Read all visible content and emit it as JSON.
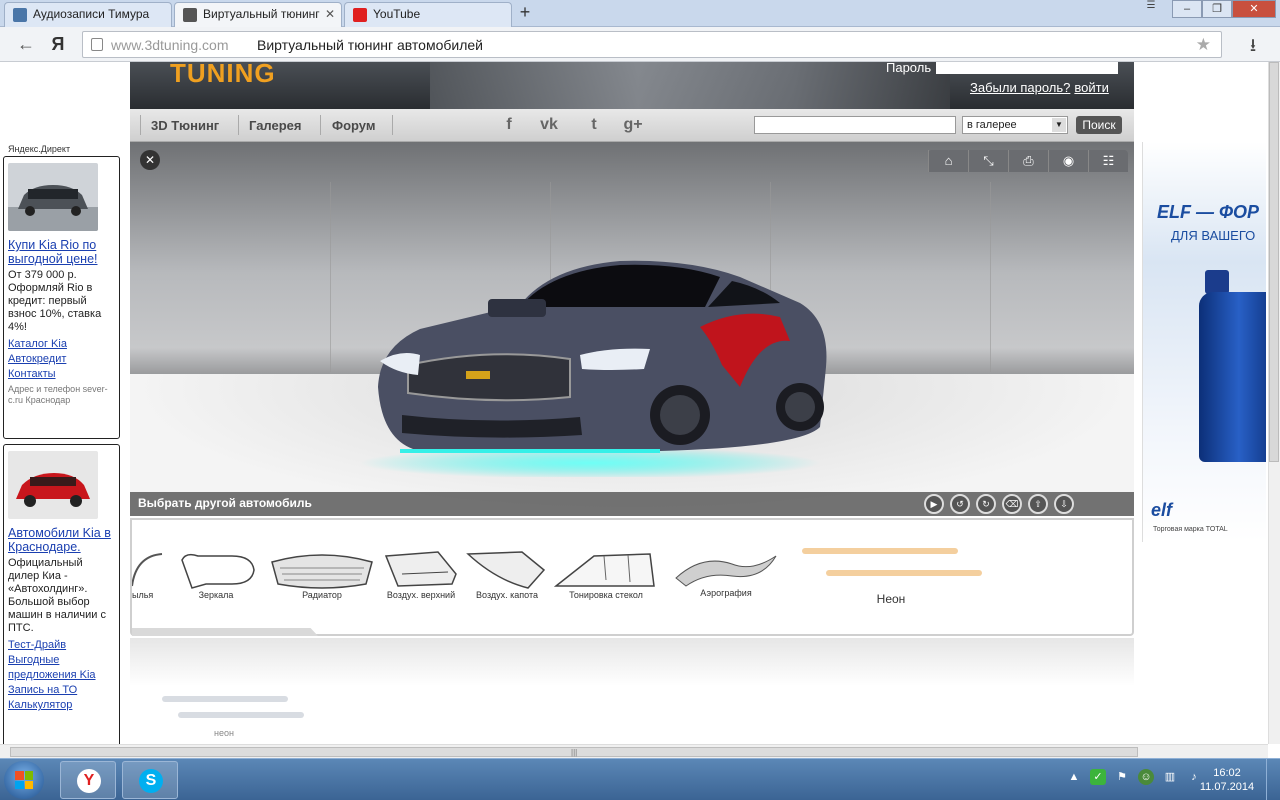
{
  "browser": {
    "tabs": [
      {
        "label": "Аудиозаписи Тимура",
        "active": false
      },
      {
        "label": "Виртуальный тюнинг",
        "active": true
      },
      {
        "label": "YouTube",
        "active": false
      }
    ],
    "new_tab": "+",
    "back": "←",
    "yandex": "Я",
    "url_domain": "www.3dtuning.com",
    "page_title": "Виртуальный тюнинг автомобилей",
    "bookmark_icon": "star-icon",
    "download_icon": "download-icon"
  },
  "site": {
    "logo": "TUNING",
    "password_label": "Пароль",
    "forgot_password": "Забыли пароль?",
    "login": "войти",
    "nav": [
      "3D Тюнинг",
      "Галерея",
      "Форум"
    ],
    "social": [
      "f",
      "vk",
      "t",
      "g+"
    ],
    "search_scope": "в галерее",
    "search_button": "Поиск",
    "choose_car": "Выбрать другой автомобиль",
    "parts": [
      {
        "label": "ылья"
      },
      {
        "label": "Зеркала"
      },
      {
        "label": "Радиатор"
      },
      {
        "label": "Воздух. верхний"
      },
      {
        "label": "Воздух. капота"
      },
      {
        "label": "Тонировка стекол"
      },
      {
        "label": "Аэрография"
      },
      {
        "label": "Неон"
      }
    ],
    "neon_sub_label": "неон"
  },
  "ads": {
    "direct_label": "Яндекс.Директ",
    "ad1": {
      "title": "Купи Kia Rio по выгодной цене!",
      "text": "От 379 000 р. Оформляй Rio в кредит: первый взнос 10%, ставка 4%!",
      "links": [
        "Каталог Kia",
        "Автокредит",
        "Контакты"
      ],
      "small": "Адрес и телефон sever-c.ru Краснодар"
    },
    "ad2": {
      "title": "Автомобили Kia в Краснодаре.",
      "text": "Официальный дилер Киа - «Автохолдинг». Большой выбор машин в наличии с ПТС.",
      "links": [
        "Тест-Драйв",
        "Выгодные предложения Kia",
        "Запись на ТО",
        "Калькулятор"
      ]
    }
  },
  "banner": {
    "headline": "ELF — ФОР",
    "subline": "ДЛЯ ВАШЕГО",
    "brand": "elf",
    "tagline": "Торговая марка TOTAL"
  },
  "taskbar": {
    "time": "16:02",
    "date": "11.07.2014"
  },
  "colors": {
    "accent_orange": "#f0a020",
    "link_blue": "#1a3fb0",
    "neon_cyan": "#35f0e8",
    "car_body": "#4a4f63",
    "decal_red": "#c0141c"
  }
}
